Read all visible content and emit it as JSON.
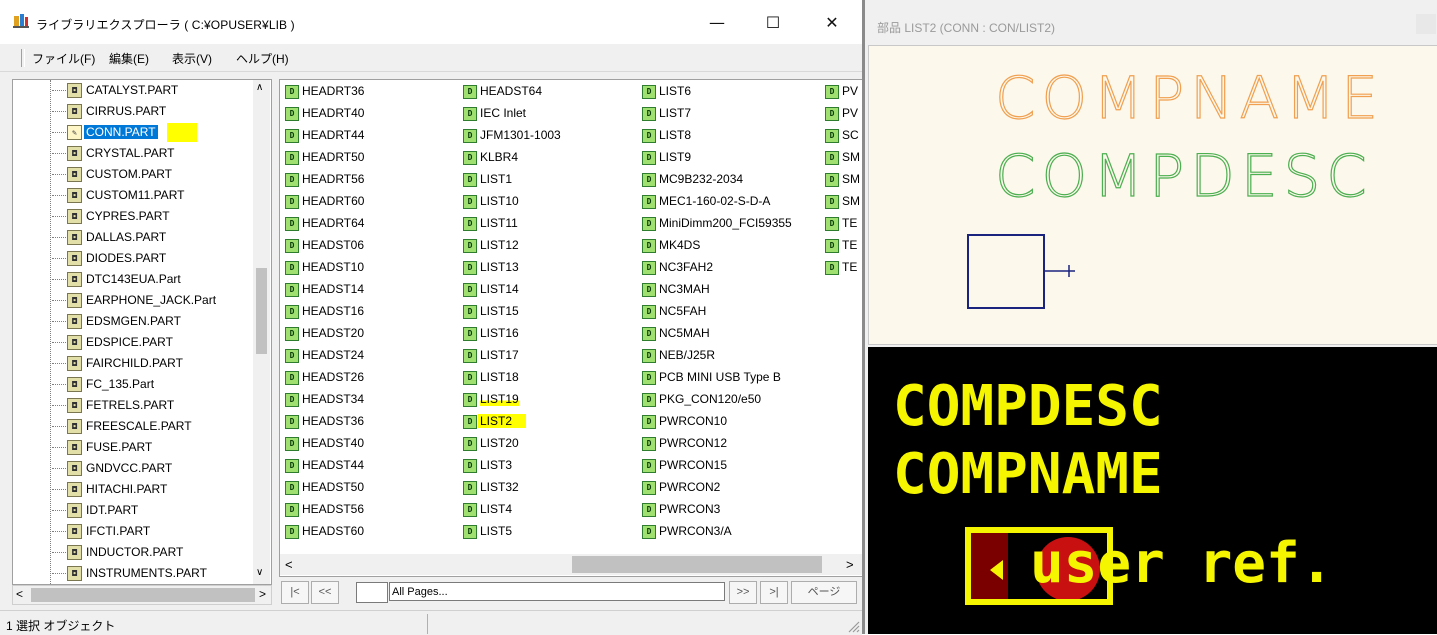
{
  "window": {
    "title": "ライブラリエクスプローラ ( C:¥OPUSER¥LIB )",
    "controls": {
      "minimize": "—",
      "maximize": "☐",
      "close": "✕"
    }
  },
  "menu": {
    "items": [
      "ファイル(F)",
      "編集(E)",
      "表示(V)",
      "ヘルプ(H)"
    ]
  },
  "tree": {
    "items": [
      "CATALYST.PART",
      "CIRRUS.PART",
      "CONN.PART",
      "CRYSTAL.PART",
      "CUSTOM.PART",
      "CUSTOM11.PART",
      "CYPRES.PART",
      "DALLAS.PART",
      "DIODES.PART",
      "DTC143EUA.Part",
      "EARPHONE_JACK.Part",
      "EDSMGEN.PART",
      "EDSPICE.PART",
      "FAIRCHILD.PART",
      "FC_135.Part",
      "FETRELS.PART",
      "FREESCALE.PART",
      "FUSE.PART",
      "GNDVCC.PART",
      "HITACHI.PART",
      "IDT.PART",
      "IFCTI.PART",
      "INDUCTOR.PART",
      "INSTRUMENTS.PART"
    ],
    "selected": "CONN.PART"
  },
  "list": {
    "columns": [
      [
        "HEADRT36",
        "HEADRT40",
        "HEADRT44",
        "HEADRT50",
        "HEADRT56",
        "HEADRT60",
        "HEADRT64",
        "HEADST06",
        "HEADST10",
        "HEADST14",
        "HEADST16",
        "HEADST20",
        "HEADST24",
        "HEADST26",
        "HEADST34",
        "HEADST36",
        "HEADST40",
        "HEADST44",
        "HEADST50",
        "HEADST56",
        "HEADST60"
      ],
      [
        "HEADST64",
        "IEC Inlet",
        "JFM1301-1003",
        "KLBR4",
        "LIST1",
        "LIST10",
        "LIST11",
        "LIST12",
        "LIST13",
        "LIST14",
        "LIST15",
        "LIST16",
        "LIST17",
        "LIST18",
        "LIST19",
        "LIST2",
        "LIST20",
        "LIST3",
        "LIST32",
        "LIST4",
        "LIST5"
      ],
      [
        "LIST6",
        "LIST7",
        "LIST8",
        "LIST9",
        "MC9B232-2034",
        "MEC1-160-02-S-D-A",
        "MiniDimm200_FCI59355",
        "MK4DS",
        "NC3FAH2",
        "NC3MAH",
        "NC5FAH",
        "NC5MAH",
        "NEB/J25R",
        "PCB MINI USB Type B",
        "PKG_CON120/e50",
        "PWRCON10",
        "PWRCON12",
        "PWRCON15",
        "PWRCON2",
        "PWRCON3",
        "PWRCON3/A"
      ],
      [
        "PV",
        "PV",
        "SC",
        "SM",
        "SM",
        "SM",
        "TE",
        "TE",
        "TE"
      ]
    ],
    "selected": "LIST2",
    "icon_text": "D"
  },
  "nav": {
    "first": "|<",
    "prev": "<<",
    "page_value": "",
    "page_select": "All Pages...",
    "next": ">>",
    "last": ">|",
    "page_button": "ページ"
  },
  "status": {
    "text": "1 選択 オブジェクト"
  },
  "preview": {
    "title": "部品 LIST2 (CONN : CON/LIST2)",
    "top": {
      "name_text": "COMPNAME",
      "desc_text": "COMPDESC"
    },
    "bottom": {
      "desc_text": "COMPDESC",
      "name_text": "COMPNAME",
      "ref_text": "user ref."
    }
  },
  "colors": {
    "orange": "#f0a050",
    "green": "#4caf50",
    "navy": "#1a237e",
    "yellow": "#f5f500",
    "dark_red": "#7a0000",
    "red": "#c81010",
    "selection": "#0078d7",
    "highlight": "#ffff00"
  }
}
